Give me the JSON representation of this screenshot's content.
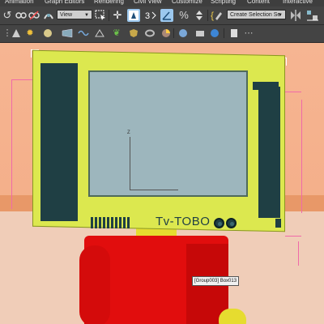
{
  "menu": {
    "items": [
      "Animation",
      "Graph Editors",
      "Rendering",
      "Civil View",
      "Customize",
      "Scripting",
      "Content",
      "Interactive"
    ]
  },
  "toolbar": {
    "view_dropdown": "View",
    "selection_set_dropdown": "Create Selection Se"
  },
  "viewport": {
    "tv_brand": "Tv-TOBO",
    "axis_label": "Z",
    "tooltip": "[Group003] Box013"
  },
  "colors": {
    "tv_frame": "#dce84f",
    "tv_dark": "#1f3f44",
    "screen": "#9db6bd",
    "background_wall": "#f4b08a",
    "body_red": "#e10d0d",
    "accent_yellow": "#e6dc2f"
  },
  "icons": {
    "toolbar": [
      "undo-icon",
      "link-icon",
      "unlink-icon",
      "bind-space-warp-icon",
      "view-dropdown",
      "select-region-icon",
      "move-icon",
      "select-object-icon",
      "snap-3d-icon",
      "angle-snap-icon",
      "percent-snap-icon",
      "spinner-snap-icon",
      "edit-named-selection-icon",
      "create-selection-set-dropdown",
      "mirror-icon",
      "align-icon"
    ],
    "toolbar2": [
      "menu-dots-icon",
      "cone-icon",
      "sun-icon",
      "sphere-icon",
      "grid-icon",
      "wave-icon",
      "helper-icon",
      "leaf-icon",
      "shield-icon",
      "torus-icon",
      "render-icon",
      "material-icon",
      "camera-icon",
      "bone-icon",
      "doc-icon",
      "dots-icon"
    ]
  }
}
